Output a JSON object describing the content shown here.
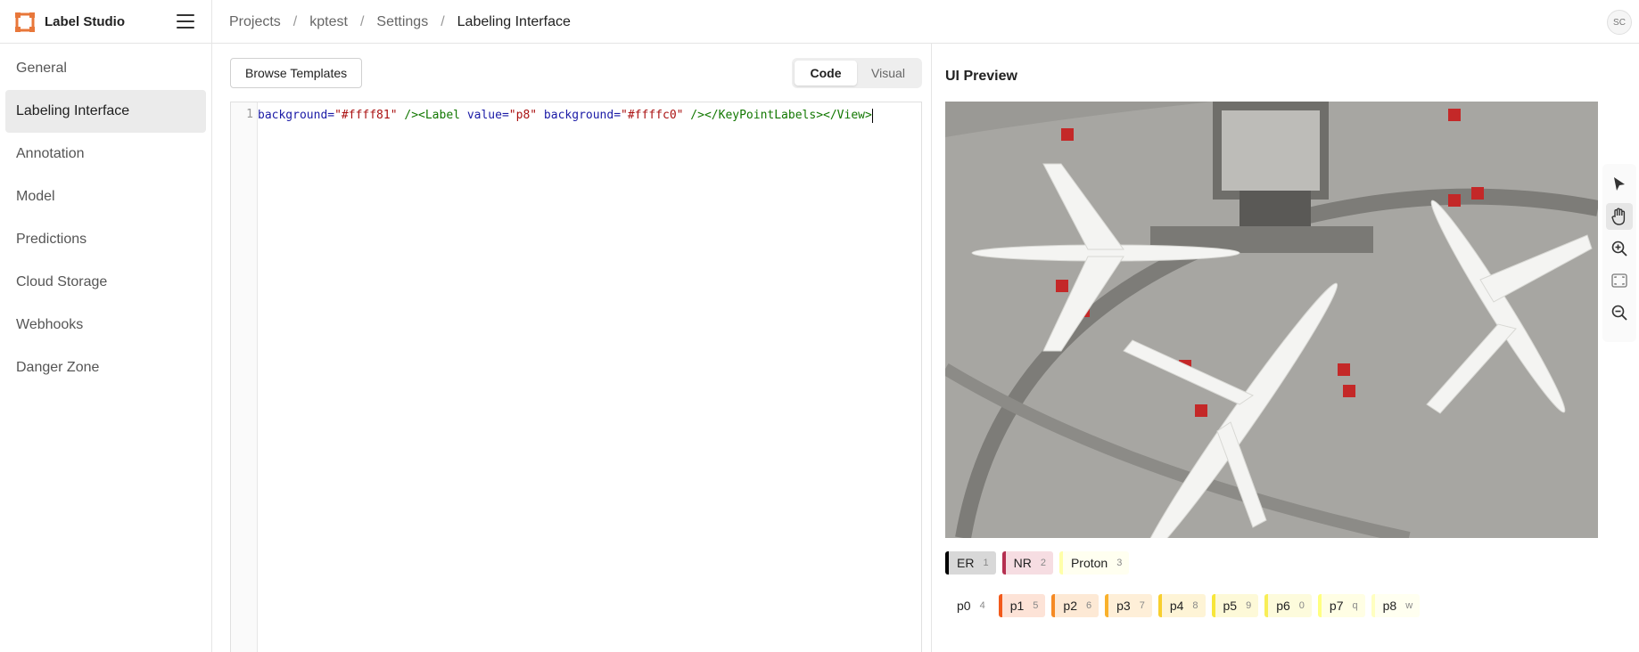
{
  "app": {
    "name": "Label Studio"
  },
  "breadcrumbs": [
    {
      "label": "Projects"
    },
    {
      "label": "kptest"
    },
    {
      "label": "Settings"
    },
    {
      "label": "Labeling Interface"
    }
  ],
  "user": {
    "initials": "SC"
  },
  "sidebar": {
    "items": [
      {
        "label": "General"
      },
      {
        "label": "Labeling Interface"
      },
      {
        "label": "Annotation"
      },
      {
        "label": "Model"
      },
      {
        "label": "Predictions"
      },
      {
        "label": "Cloud Storage"
      },
      {
        "label": "Webhooks"
      },
      {
        "label": "Danger Zone"
      }
    ],
    "active": "Labeling Interface"
  },
  "editor": {
    "browse_label": "Browse Templates",
    "tabs": [
      {
        "label": "Code"
      },
      {
        "label": "Visual"
      }
    ],
    "active_tab": "Code",
    "line_number": "1",
    "code": {
      "t1": "background=",
      "t2": "\"#ffff81\"",
      "t3": " /><Label ",
      "t4": "value=",
      "t5": "\"p8\"",
      "t6": " background=",
      "t7": "\"#ffffc0\"",
      "t8": " /></KeyPointLabels></View>"
    }
  },
  "preview": {
    "title": "UI Preview",
    "tools": [
      "pointer-icon",
      "hand-pan-icon",
      "zoom-in-icon",
      "fit-screen-icon",
      "zoom-out-icon"
    ],
    "label_groups": [
      [
        {
          "name": "ER",
          "hotkey": "1",
          "color": "#000000",
          "bg": "#d8d8d8"
        },
        {
          "name": "NR",
          "hotkey": "2",
          "color": "#b53050",
          "bg": "#f6dde2"
        },
        {
          "name": "Proton",
          "hotkey": "3",
          "color": "#ffffa8",
          "bg": "#fffff0"
        }
      ],
      [
        {
          "name": "p0",
          "hotkey": "4",
          "color": "#ffffff",
          "bg": "#ffffff"
        },
        {
          "name": "p1",
          "hotkey": "5",
          "color": "#f25a1b",
          "bg": "#fde3d7"
        },
        {
          "name": "p2",
          "hotkey": "6",
          "color": "#f58a24",
          "bg": "#fde9d5"
        },
        {
          "name": "p3",
          "hotkey": "7",
          "color": "#f9b12c",
          "bg": "#feefd8"
        },
        {
          "name": "p4",
          "hotkey": "8",
          "color": "#f8cf2e",
          "bg": "#fef4d6"
        },
        {
          "name": "p5",
          "hotkey": "9",
          "color": "#f7e63a",
          "bg": "#fdf9d8"
        },
        {
          "name": "p6",
          "hotkey": "0",
          "color": "#f8ee57",
          "bg": "#fdfbdc"
        },
        {
          "name": "p7",
          "hotkey": "q",
          "color": "#ffff81",
          "bg": "#fffee4"
        },
        {
          "name": "p8",
          "hotkey": "w",
          "color": "#ffffc0",
          "bg": "#fffff0"
        }
      ]
    ]
  }
}
